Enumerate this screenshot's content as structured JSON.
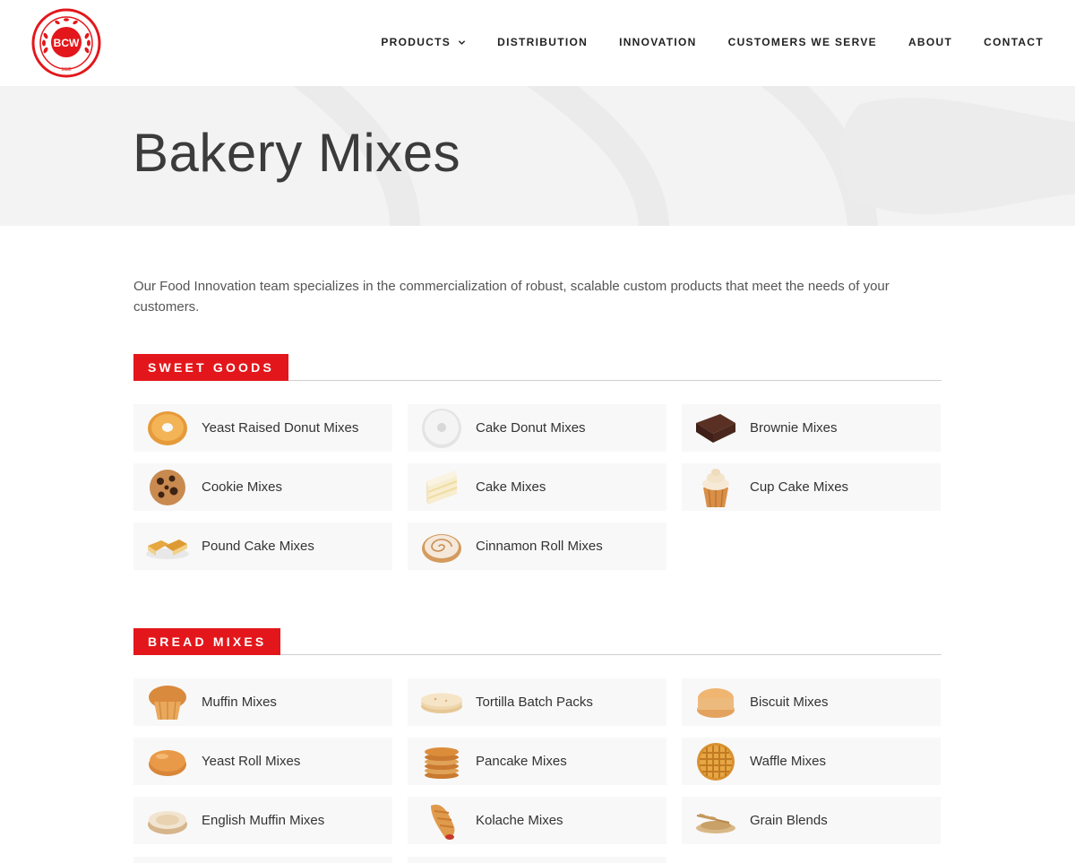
{
  "brand": {
    "logo_text": "BCW",
    "logo_year": "1935",
    "accent": "#e3171b"
  },
  "nav": [
    {
      "label": "PRODUCTS",
      "has_dropdown": true
    },
    {
      "label": "DISTRIBUTION"
    },
    {
      "label": "INNOVATION"
    },
    {
      "label": "CUSTOMERS WE SERVE"
    },
    {
      "label": "ABOUT"
    },
    {
      "label": "CONTACT"
    }
  ],
  "hero": {
    "title": "Bakery Mixes"
  },
  "intro": "Our Food Innovation team specializes in the commercialization of robust, scalable custom products that meet the needs of your customers.",
  "sections": [
    {
      "title": "SWEET GOODS",
      "items": [
        {
          "label": "Yeast Raised Donut Mixes",
          "icon": "donut-icon"
        },
        {
          "label": "Cake Donut Mixes",
          "icon": "powdered-donut-icon"
        },
        {
          "label": "Brownie Mixes",
          "icon": "brownie-icon"
        },
        {
          "label": "Cookie Mixes",
          "icon": "cookie-icon"
        },
        {
          "label": "Cake Mixes",
          "icon": "cake-slice-icon"
        },
        {
          "label": "Cup Cake Mixes",
          "icon": "cupcake-icon"
        },
        {
          "label": "Pound Cake Mixes",
          "icon": "pound-cake-icon"
        },
        {
          "label": "Cinnamon Roll Mixes",
          "icon": "cinnamon-roll-icon"
        }
      ]
    },
    {
      "title": "BREAD MIXES",
      "items": [
        {
          "label": "Muffin Mixes",
          "icon": "muffin-icon"
        },
        {
          "label": "Tortilla Batch Packs",
          "icon": "tortilla-icon"
        },
        {
          "label": "Biscuit Mixes",
          "icon": "biscuit-icon"
        },
        {
          "label": "Yeast Roll Mixes",
          "icon": "roll-icon"
        },
        {
          "label": "Pancake Mixes",
          "icon": "pancake-icon"
        },
        {
          "label": "Waffle Mixes",
          "icon": "waffle-icon"
        },
        {
          "label": "English Muffin Mixes",
          "icon": "english-muffin-icon"
        },
        {
          "label": "Kolache Mixes",
          "icon": "kolache-icon"
        },
        {
          "label": "Grain Blends",
          "icon": "grain-icon"
        }
      ]
    }
  ]
}
